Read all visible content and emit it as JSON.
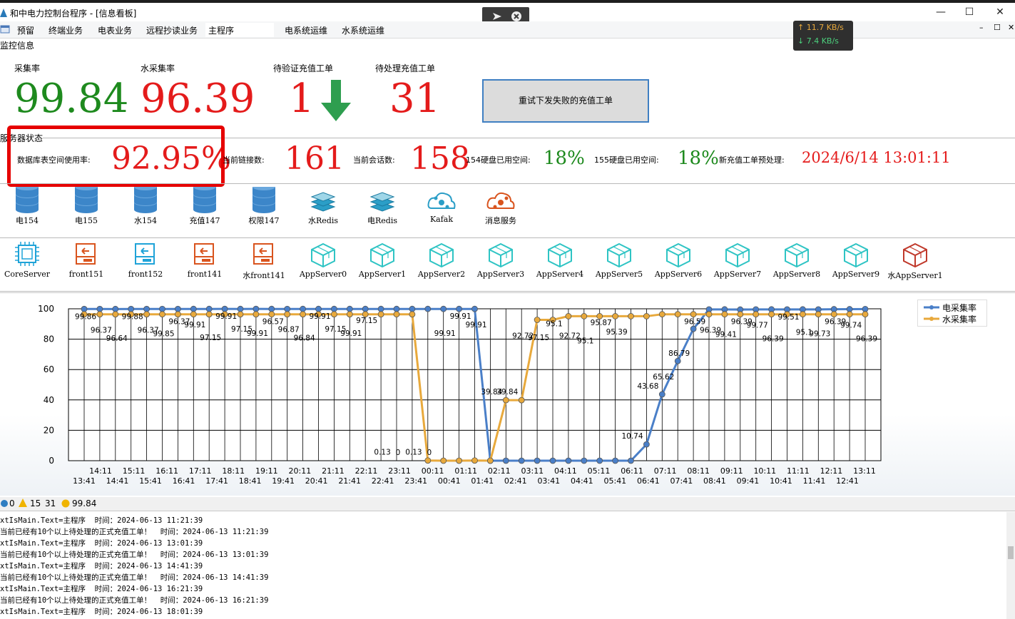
{
  "window": {
    "title": "和中电力控制台程序 - [信息看板]",
    "minimize": "—",
    "maximize": "☐",
    "close": "✕"
  },
  "menu": {
    "items": [
      "预留",
      "终端业务",
      "电表业务",
      "远程抄读业务",
      "主程序",
      "电系统运维",
      "水系统运维"
    ],
    "restore": "☐",
    "close_child": "✕",
    "min_child": "–"
  },
  "netspeed": {
    "up": "↑ 11.7 KB/s",
    "down": "↓ 7.4 KB/s"
  },
  "monitor": {
    "section": "监控信息",
    "collect_rate_label": "采集率",
    "collect_rate_value": "99.84",
    "water_rate_label": "水采集率",
    "water_rate_value": "96.39",
    "pending_verify_label": "待验证充值工单",
    "pending_verify_value": "1",
    "pending_process_label": "待处理充值工单",
    "pending_process_value": "31",
    "retry_button": "重试下发失败的充值工单"
  },
  "server_status": {
    "section": "服务器状态",
    "db_usage_label": "数据库表空间使用率:",
    "db_usage_value": "92.95%",
    "conn_label": "当前链接数:",
    "conn_value": "161",
    "session_label": "当前会话数:",
    "session_value": "158",
    "disk154_label": "154硬盘已用空间:",
    "disk154_value": "18%",
    "disk155_label": "155硬盘已用空间:",
    "disk155_value": "18%",
    "prepay_label": "新充值工单预处理:",
    "prepay_value": "2024/6/14  13:01:11"
  },
  "db_icons": [
    {
      "label": "电154",
      "icon": "database-icon"
    },
    {
      "label": "电155",
      "icon": "database-icon"
    },
    {
      "label": "水154",
      "icon": "database-icon"
    },
    {
      "label": "充值147",
      "icon": "database-icon"
    },
    {
      "label": "权限147",
      "icon": "database-icon"
    },
    {
      "label": "水Redis",
      "icon": "redis-icon"
    },
    {
      "label": "电Redis",
      "icon": "redis-icon"
    },
    {
      "label": "Kafak",
      "icon": "kafka-icon"
    },
    {
      "label": "消息服务",
      "icon": "message-service-icon"
    }
  ],
  "server_icons": [
    {
      "label": "CoreServer",
      "icon": "chip-icon",
      "color": "#1fa3d8"
    },
    {
      "label": "front151",
      "icon": "front-server-icon",
      "color": "#d9541e"
    },
    {
      "label": "front152",
      "icon": "front-server-icon",
      "color": "#1fa3d8"
    },
    {
      "label": "front141",
      "icon": "front-server-icon",
      "color": "#d9541e"
    },
    {
      "label": "水front141",
      "icon": "front-server-icon",
      "color": "#d9541e"
    },
    {
      "label": "AppServer0",
      "icon": "cube-icon",
      "color": "#2ec4c4"
    },
    {
      "label": "AppServer1",
      "icon": "cube-icon",
      "color": "#2ec4c4"
    },
    {
      "label": "AppServer2",
      "icon": "cube-icon",
      "color": "#2ec4c4"
    },
    {
      "label": "AppServer3",
      "icon": "cube-icon",
      "color": "#2ec4c4"
    },
    {
      "label": "AppServer4",
      "icon": "cube-icon",
      "color": "#2ec4c4"
    },
    {
      "label": "AppServer5",
      "icon": "cube-icon",
      "color": "#2ec4c4"
    },
    {
      "label": "AppServer6",
      "icon": "cube-icon",
      "color": "#2ec4c4"
    },
    {
      "label": "AppServer7",
      "icon": "cube-icon",
      "color": "#2ec4c4"
    },
    {
      "label": "AppServer8",
      "icon": "cube-icon",
      "color": "#2ec4c4"
    },
    {
      "label": "AppServer9",
      "icon": "cube-icon",
      "color": "#2ec4c4"
    },
    {
      "label": "水AppServer1",
      "icon": "cube-icon",
      "color": "#c0392b"
    }
  ],
  "status_strip": {
    "errors": "0",
    "warnings": "15",
    "warnings2": "31",
    "info": "99.84"
  },
  "log_lines": [
    "xtIsMain.Text=主程序  时间：2024-06-13 11:21:39",
    "当前已经有10个以上待处理的正式充值工单！  时间：2024-06-13 11:21:39",
    "xtIsMain.Text=主程序  时间：2024-06-13 13:01:39",
    "当前已经有10个以上待处理的正式充值工单！  时间：2024-06-13 13:01:39",
    "xtIsMain.Text=主程序  时间：2024-06-13 14:41:39",
    "当前已经有10个以上待处理的正式充值工单！  时间：2024-06-13 14:41:39",
    "xtIsMain.Text=主程序  时间：2024-06-13 16:21:39",
    "当前已经有10个以上待处理的正式充值工单！  时间：2024-06-13 16:21:39",
    "xtIsMain.Text=主程序  时间：2024-06-13 18:01:39"
  ],
  "colors": {
    "green": "#1e8a1e",
    "red": "#e41b1b",
    "elec_series": "#4a7fc8",
    "water_series": "#e8a93c"
  },
  "chart_data": {
    "type": "line",
    "legend_position": "top-right",
    "ylim": [
      0,
      100
    ],
    "yticks": [
      0,
      20,
      40,
      60,
      80,
      100
    ],
    "grid": true,
    "x_upper": [
      "14:11",
      "15:11",
      "16:11",
      "17:11",
      "18:11",
      "19:11",
      "20:11",
      "21:11",
      "22:11",
      "23:11",
      "00:11",
      "01:11",
      "02:11",
      "03:11",
      "04:11",
      "05:11",
      "06:11",
      "07:11",
      "08:11",
      "09:11",
      "10:11",
      "11:11",
      "12:11",
      "13:11"
    ],
    "x_lower": [
      "13:41",
      "14:41",
      "15:41",
      "16:41",
      "17:41",
      "18:41",
      "19:41",
      "20:41",
      "21:41",
      "22:41",
      "23:41",
      "00:41",
      "01:41",
      "02:41",
      "03:41",
      "04:41",
      "05:41",
      "06:41",
      "07:41",
      "08:41",
      "09:41",
      "10:41",
      "11:41",
      "12:41"
    ],
    "series": [
      {
        "name": "电采集率",
        "values": [
          99.86,
          99.88,
          99.85,
          99.88,
          99.86,
          99.9,
          99.88,
          99.91,
          99.91,
          99.92,
          99.91,
          99.92,
          99.91,
          99.9,
          99.91,
          99.91,
          99.91,
          99.91,
          99.91,
          99.91,
          99.91,
          99.91,
          99.91,
          99.91,
          99.91,
          99.91,
          0,
          0,
          0,
          0,
          0,
          0,
          0,
          0,
          0,
          0,
          10.74,
          43.68,
          65.62,
          86.79,
          99.59,
          99.61,
          99.5,
          99.6,
          99.61,
          99.58,
          99.61,
          99.59,
          99.73,
          99.74,
          99.84
        ]
      },
      {
        "name": "水采集率",
        "values": [
          96.37,
          96.37,
          96.37,
          96.37,
          96.37,
          96.39,
          96.37,
          96.39,
          96.37,
          96.39,
          96.37,
          96.37,
          96.39,
          96.37,
          96.37,
          96.39,
          96.37,
          96.37,
          96.39,
          96.37,
          96.39,
          96.37,
          0.13,
          0,
          0,
          0.13,
          0,
          39.84,
          39.84,
          92.72,
          92.72,
          95.1,
          95.1,
          95.1,
          95.1,
          95.1,
          95.1,
          96.39,
          96.39,
          96.39,
          96.39,
          96.39,
          96.39,
          96.39,
          96.39,
          96.39,
          96.39,
          96.39,
          96.39,
          96.39,
          96.39
        ]
      }
    ],
    "point_labels": [
      "99.86",
      "96.37",
      "96.64",
      "99.88",
      "96.37",
      "99.85",
      "96.37",
      "99.91",
      "97.15",
      "99.91",
      "97.15",
      "99.91",
      "96.57",
      "96.87",
      "96.84",
      "99.91",
      "97.15",
      "99.91",
      "97.15",
      "0.13",
      "0",
      "0.13",
      "0",
      "99.91",
      "99.91",
      "99.91",
      "39.84",
      "39.84",
      "92.72",
      "97.15",
      "95.1",
      "92.72",
      "95.1",
      "95.87",
      "95.39",
      "10.74",
      "43.68",
      "65.62",
      "86.79",
      "96.59",
      "96.39",
      "99.41",
      "96.39",
      "99.77",
      "96.39",
      "99.51",
      "95.1",
      "99.73",
      "96.39",
      "99.74",
      "96.39"
    ]
  }
}
